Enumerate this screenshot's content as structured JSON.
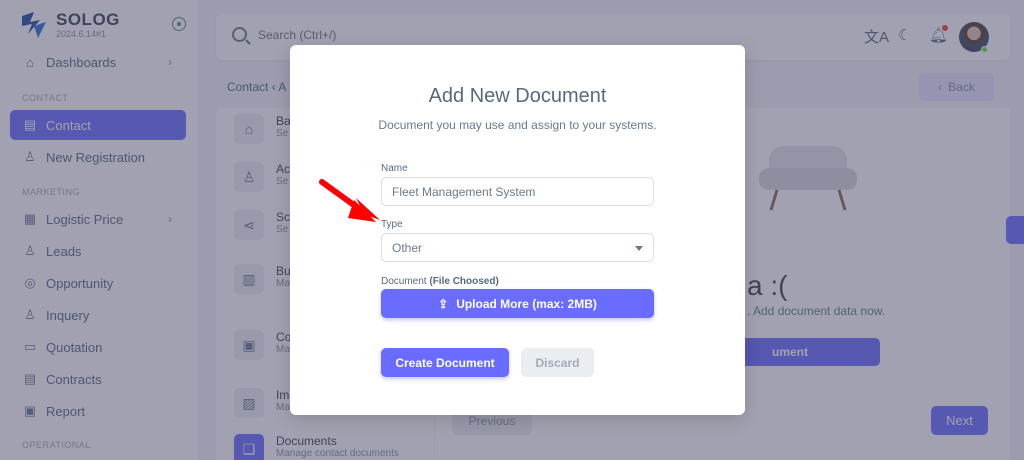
{
  "brand": {
    "name": "SOLOG",
    "version": "2024.6.14#1"
  },
  "sidebar": {
    "items": [
      {
        "label": "Dashboards",
        "icon": "home-icon",
        "chevron": true
      },
      {
        "header": "CONTACT"
      },
      {
        "label": "Contact",
        "icon": "contact-icon",
        "active": true
      },
      {
        "label": "New Registration",
        "icon": "user-icon"
      },
      {
        "header": "MARKETING"
      },
      {
        "label": "Logistic Price",
        "icon": "list-icon",
        "chevron": true
      },
      {
        "label": "Leads",
        "icon": "leads-icon"
      },
      {
        "label": "Opportunity",
        "icon": "opportunity-icon"
      },
      {
        "label": "Inquery",
        "icon": "inquery-icon"
      },
      {
        "label": "Quotation",
        "icon": "quotation-icon"
      },
      {
        "label": "Contracts",
        "icon": "contracts-icon"
      },
      {
        "label": "Report",
        "icon": "report-icon"
      },
      {
        "header": "OPERATIONAL"
      }
    ]
  },
  "topbar": {
    "search_placeholder": "Search (Ctrl+/)"
  },
  "breadcrumb": {
    "root": "Contact",
    "sep": "‹",
    "current": "A"
  },
  "back_label": "Back",
  "steps": [
    {
      "title": "Ba",
      "sub": "Se",
      "icon": "bank-icon"
    },
    {
      "title": "Ac",
      "sub": "Se",
      "icon": "user-icon"
    },
    {
      "title": "Sc",
      "sub": "Se",
      "icon": "share-icon"
    },
    {
      "title": "Bu",
      "sub": "Ma",
      "icon": "building-icon"
    },
    {
      "title": "Co",
      "sub": "Ma",
      "icon": "contact-icon"
    },
    {
      "title": "Im",
      "sub": "Ma",
      "icon": "image-icon"
    },
    {
      "title": "Documents",
      "sub": "Manage contact documents",
      "icon": "documents-icon",
      "active": true
    }
  ],
  "empty_state": {
    "title": "a :(",
    "subtitle": ". Add document data now.",
    "button": "ument"
  },
  "nav_buttons": {
    "previous": "Previous",
    "next": "Next"
  },
  "modal": {
    "title": "Add New Document",
    "subtitle": "Document you may use and assign to your systems.",
    "name_label": "Name",
    "name_value": "Fleet Management System",
    "type_label": "Type",
    "type_value": "Other",
    "document_label": "Document",
    "document_status": "(File Choosed)",
    "upload_label": "Upload More (max: 2MB)",
    "create_label": "Create Document",
    "discard_label": "Discard"
  },
  "colors": {
    "primary": "#696cff",
    "annotation_arrow": "#ff0000"
  }
}
